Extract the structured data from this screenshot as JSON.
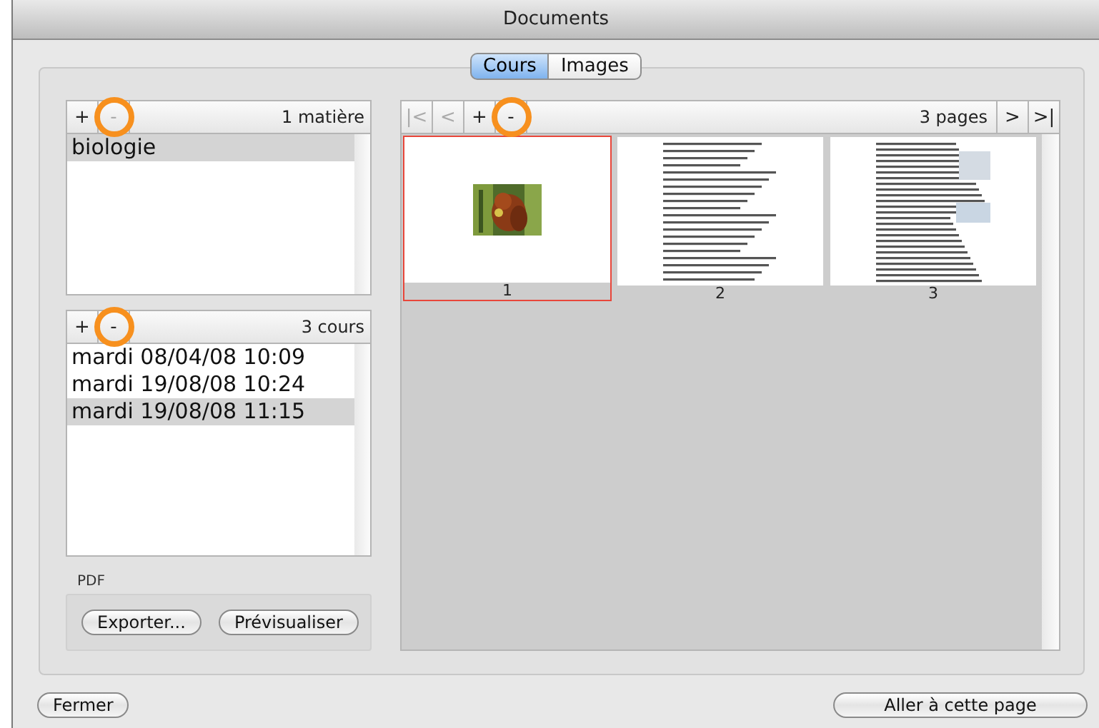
{
  "window": {
    "title": "Documents"
  },
  "tabs": [
    {
      "label": "Cours",
      "selected": true
    },
    {
      "label": "Images",
      "selected": false
    }
  ],
  "subjects": {
    "buttons": [
      {
        "label": "+",
        "disabled": false,
        "circled": false
      },
      {
        "label": "-",
        "disabled": true,
        "circled": true
      }
    ],
    "count": "1 matière",
    "items": [
      {
        "label": "biologie",
        "selected": true
      }
    ]
  },
  "lessons": {
    "buttons": [
      {
        "label": "+",
        "disabled": false,
        "circled": false
      },
      {
        "label": "-",
        "disabled": false,
        "circled": true
      }
    ],
    "count": "3 cours",
    "items": [
      {
        "label": "mardi 08/04/08 10:09",
        "selected": false
      },
      {
        "label": "mardi 19/08/08 10:24",
        "selected": false
      },
      {
        "label": "mardi 19/08/08 11:15",
        "selected": true
      }
    ]
  },
  "pdf": {
    "label": "PDF",
    "buttons": [
      "Exporter...",
      "Prévisualiser"
    ]
  },
  "pages": {
    "left_buttons": [
      {
        "label": "|<",
        "disabled": true,
        "circled": false
      },
      {
        "label": "<",
        "disabled": true,
        "circled": false
      },
      {
        "label": "+",
        "disabled": false,
        "circled": false
      },
      {
        "label": "-",
        "disabled": false,
        "circled": true
      }
    ],
    "count": "3 pages",
    "right_buttons": [
      {
        "label": ">",
        "disabled": false,
        "circled": false
      },
      {
        "label": ">|",
        "disabled": false,
        "circled": false
      }
    ],
    "thumbnails": [
      {
        "label": "1",
        "kind": "picture",
        "selected": true
      },
      {
        "label": "2",
        "kind": "document",
        "selected": false
      },
      {
        "label": "3",
        "kind": "document",
        "selected": false
      }
    ]
  },
  "footer": {
    "close": "Fermer",
    "go": "Aller à cette page"
  }
}
